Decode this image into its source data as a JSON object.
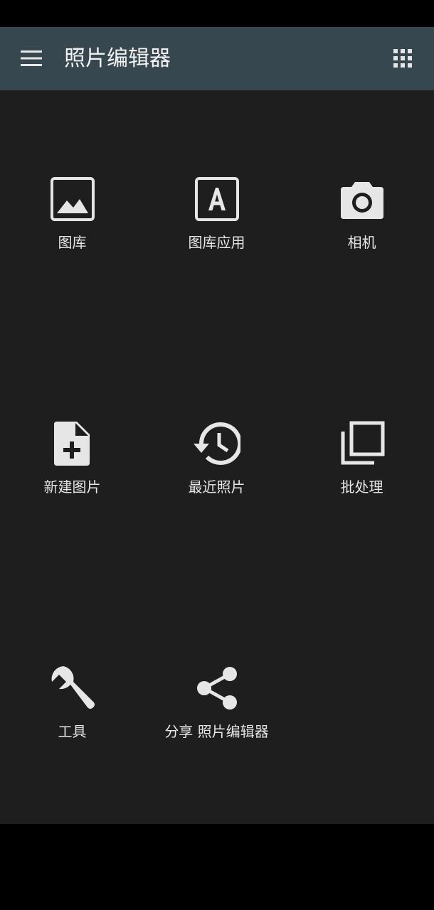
{
  "app_bar": {
    "title": "照片编辑器",
    "menu_icon": "hamburger-menu-icon",
    "apps_icon": "apps-grid-icon"
  },
  "grid": {
    "items": [
      {
        "label": "图库",
        "icon": "image-icon"
      },
      {
        "label": "图库应用",
        "icon": "letter-a-box-icon"
      },
      {
        "label": "相机",
        "icon": "camera-icon"
      },
      {
        "label": "新建图片",
        "icon": "new-file-icon"
      },
      {
        "label": "最近照片",
        "icon": "history-icon"
      },
      {
        "label": "批处理",
        "icon": "stacked-layers-icon"
      },
      {
        "label": "工具",
        "icon": "wrench-icon"
      },
      {
        "label": "分享 照片编辑器",
        "icon": "share-icon"
      }
    ]
  },
  "colors": {
    "app_bar": "#37474f",
    "background": "#1e1e1e",
    "icon": "#e6e6e6",
    "text": "#e6e6e6"
  }
}
